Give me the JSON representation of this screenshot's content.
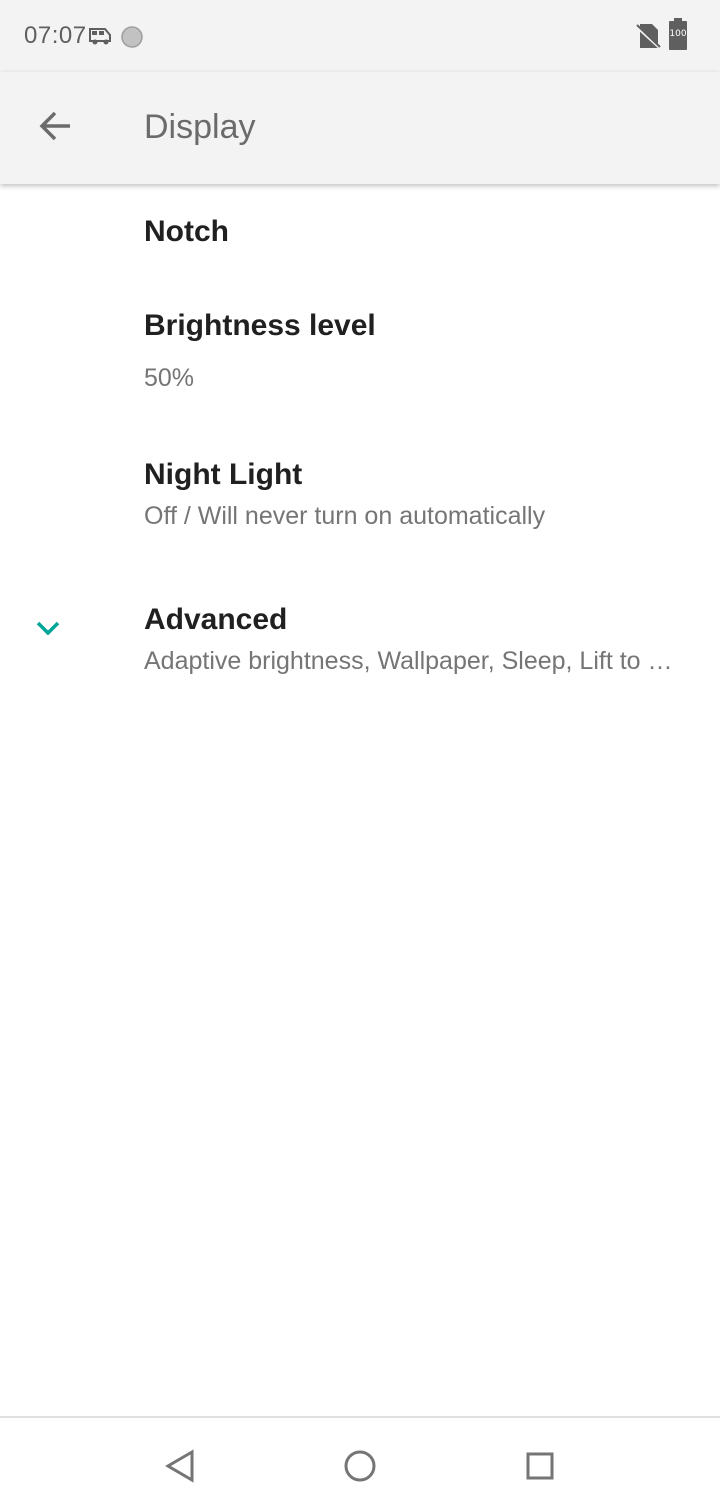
{
  "status_bar": {
    "time": "07:07",
    "battery_level": "100",
    "icons": [
      "van-icon",
      "circle-notification-icon",
      "no-sim-icon",
      "battery-icon"
    ]
  },
  "app_bar": {
    "title": "Display",
    "back_icon": "arrow-back-icon"
  },
  "preferences": [
    {
      "title": "Notch",
      "summary": ""
    },
    {
      "title": "Brightness level",
      "summary": "50%"
    },
    {
      "title": "Night Light",
      "summary": "Off / Will never turn on automatically"
    },
    {
      "title": "Advanced",
      "summary": "Adaptive brightness, Wallpaper, Sleep, Lift to wake, Font size",
      "icon": "chevron-down-icon"
    }
  ],
  "nav_bar": {
    "buttons": [
      "back-triangle-icon",
      "home-circle-icon",
      "recents-square-icon"
    ]
  },
  "colors": {
    "accent": "#00a59a",
    "bar_background": "#f3f3f3",
    "title_text": "#202020",
    "summary_text": "#757575"
  }
}
